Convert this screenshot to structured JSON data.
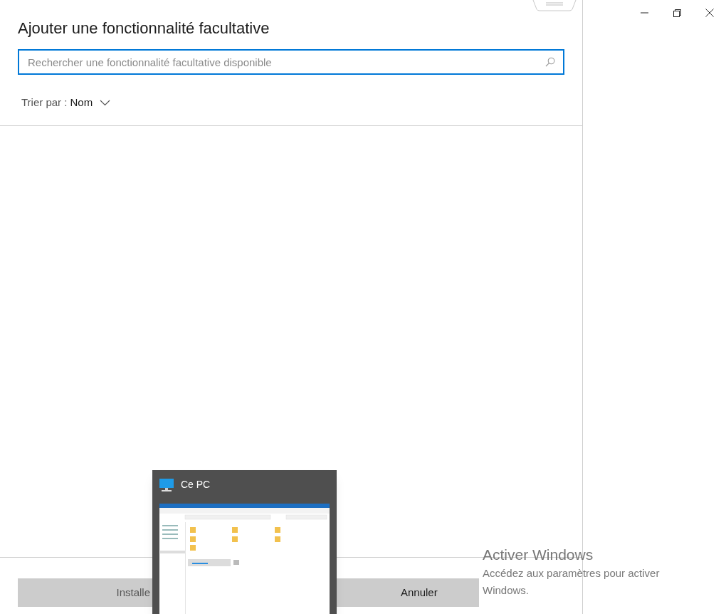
{
  "dialog": {
    "title": "Ajouter une fonctionnalité facultative",
    "search": {
      "placeholder": "Rechercher une fonctionnalité facultative disponible"
    },
    "sort": {
      "label": "Trier par :",
      "value": "Nom"
    },
    "buttons": [
      {
        "label": "Installe",
        "kind": "primary"
      },
      {
        "label": "Annuler",
        "kind": "secondary"
      }
    ]
  },
  "taskbar_preview": {
    "title": "Ce PC"
  },
  "activation_notice": {
    "title": "Activer Windows",
    "message": "Accédez aux paramètres pour activer Windows."
  }
}
